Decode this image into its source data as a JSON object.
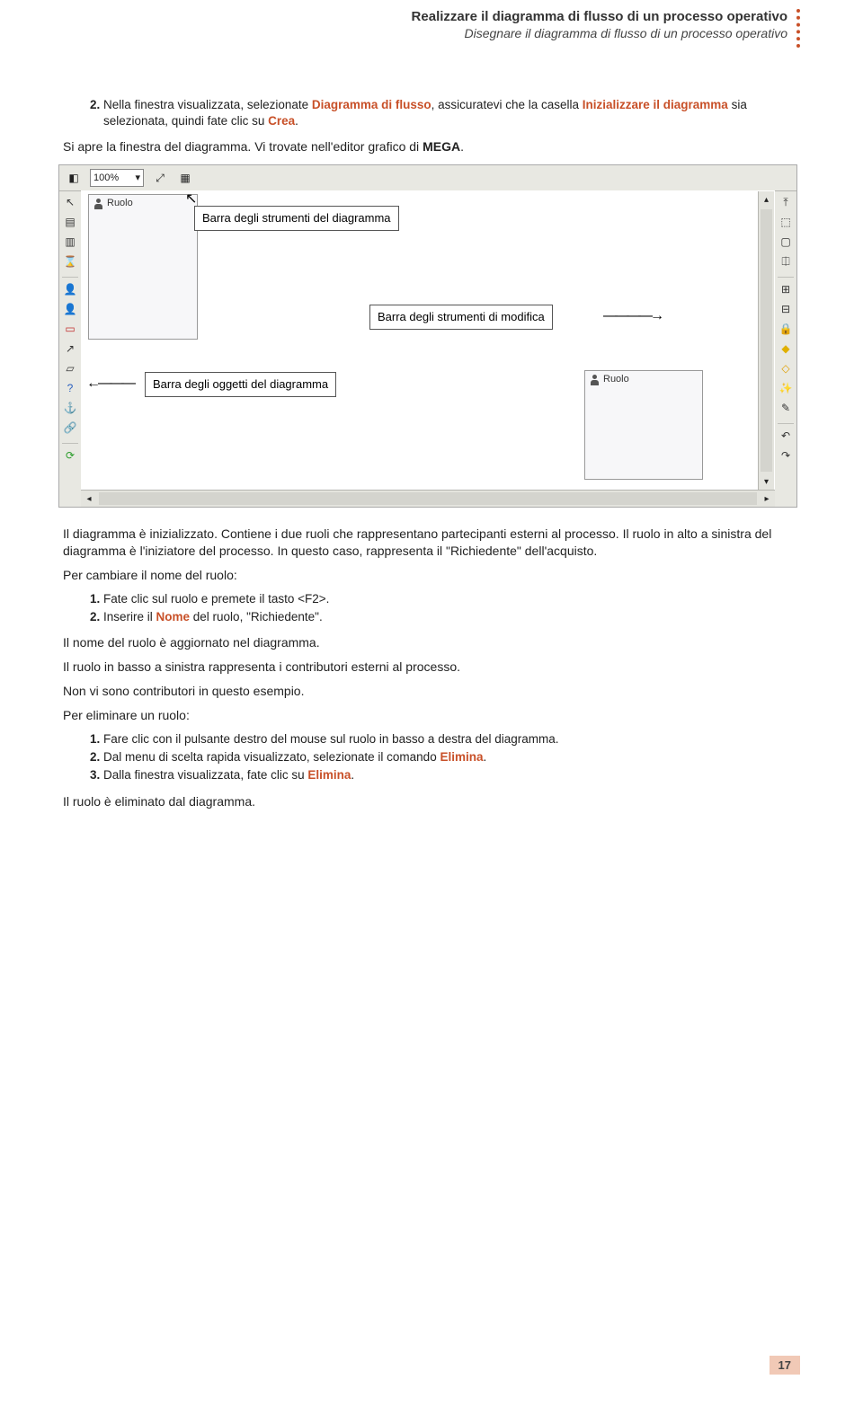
{
  "header": {
    "title": "Realizzare il diagramma di flusso di un processo operativo",
    "subtitle": "Disegnare il diagramma di flusso di un processo operativo"
  },
  "intro_list": {
    "item2_num": "2.",
    "item2_text_a": "Nella finestra visualizzata, selezionate ",
    "item2_diag": "Diagramma di flusso",
    "item2_text_b": ", assicuratevi che la casella ",
    "item2_init": "Inizializzare il diagramma",
    "item2_text_c": " sia selezionata, quindi fate clic su ",
    "item2_crea": "Crea",
    "item2_text_d": "."
  },
  "intro_line": {
    "a": "Si apre la finestra del diagramma. Vi trovate nell'editor grafico di ",
    "b": "MEGA",
    "c": "."
  },
  "editor": {
    "zoom": "100%",
    "ruolo": "Ruolo",
    "callout_tools": "Barra degli strumenti del diagramma",
    "callout_objs": "Barra degli oggetti del diagramma",
    "callout_mod": "Barra degli strumenti di modifica"
  },
  "afterimg": {
    "p1": "Il diagramma è inizializzato. Contiene i due ruoli che rappresentano partecipanti esterni al processo. Il ruolo in alto a sinistra del diagramma è l'iniziatore del processo. In questo caso, rappresenta il \"Richiedente\" dell'acquisto.",
    "p2": "Per cambiare il nome del ruolo:"
  },
  "changeList": {
    "i1": "Fate clic sul ruolo e premete il tasto <F2>.",
    "i2_a": "Inserire il ",
    "i2_b": "Nome",
    "i2_c": " del ruolo, \"Richiedente\"."
  },
  "midblock": {
    "l1": "Il nome del ruolo è aggiornato nel diagramma.",
    "l2": "Il ruolo in basso a sinistra rappresenta i contributori esterni al processo.",
    "l3": "Non vi sono contributori in questo esempio.",
    "l4": "Per eliminare un ruolo:"
  },
  "deleteList": {
    "i1": "Fare clic con il pulsante destro del mouse sul ruolo in basso a destra del diagramma.",
    "i2_a": "Dal menu di scelta rapida visualizzato, selezionate il comando ",
    "i2_b": "Elimina",
    "i2_c": ".",
    "i3_a": "Dalla finestra visualizzata, fate clic su ",
    "i3_b": "Elimina",
    "i3_c": "."
  },
  "end": "Il ruolo è eliminato dal diagramma.",
  "pageNum": "17"
}
